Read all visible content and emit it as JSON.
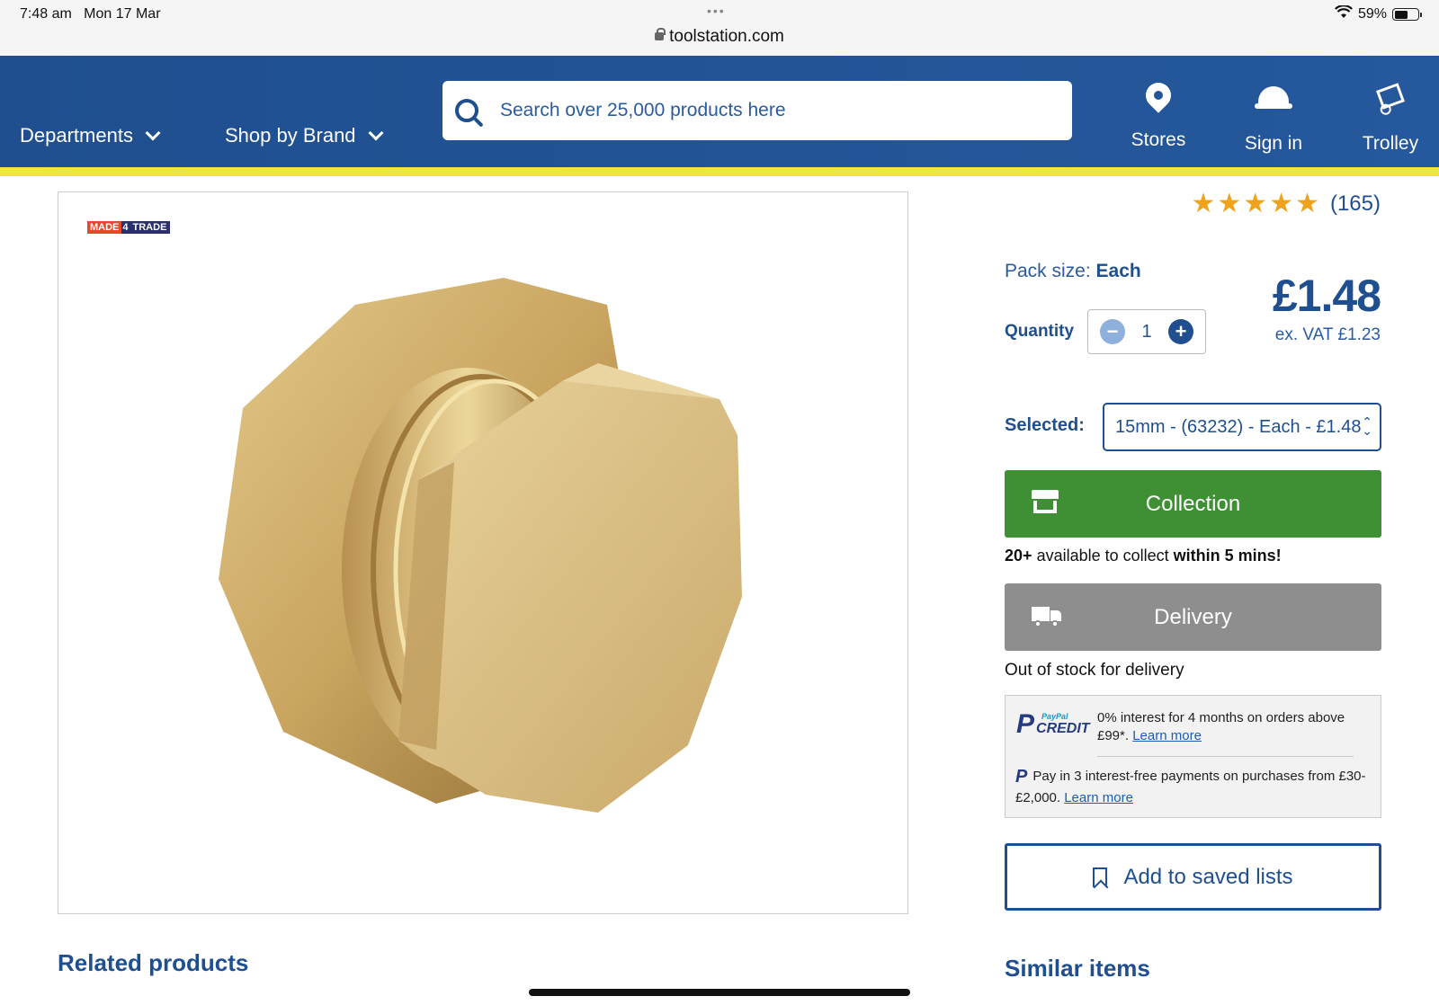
{
  "status_bar": {
    "time": "7:48 am",
    "date": "Mon 17 Mar",
    "url": "toolstation.com",
    "battery": "59%"
  },
  "header": {
    "departments": "Departments",
    "shop_by_brand": "Shop by Brand",
    "search_placeholder": "Search over 25,000 products here",
    "stores": "Stores",
    "sign_in": "Sign in",
    "trolley": "Trolley"
  },
  "product": {
    "badge_left": "MADE",
    "badge_mid": "4",
    "badge_right": "TRADE",
    "rating_stars": 5,
    "rating_count": "(165)",
    "pack_label": "Pack size:",
    "pack_value": "Each",
    "price": "£1.48",
    "price_ex_vat": "ex. VAT £1.23",
    "quantity_label": "Quantity",
    "quantity_value": "1",
    "selected_label": "Selected:",
    "selected_value": "15mm - (63232) - Each - £1.48"
  },
  "fulfilment": {
    "collection_label": "Collection",
    "collect_count": "20+",
    "collect_text": "available to collect",
    "collect_time": "within 5 mins!",
    "delivery_label": "Delivery",
    "delivery_status": "Out of stock for delivery"
  },
  "paypal": {
    "logo_small": "PayPal",
    "logo_credit": "CREDIT",
    "credit_text": "0% interest for 4 months on orders above £99*.",
    "credit_link": "Learn more",
    "pay3_text": "Pay in 3 interest-free payments on purchases from £30-£2,000.",
    "pay3_link": "Learn more"
  },
  "actions": {
    "save_label": "Add to saved lists"
  },
  "sections": {
    "related": "Related products",
    "similar": "Similar items"
  },
  "colors": {
    "brand_blue": "#1f4f8f",
    "accent_yellow": "#f5e33e",
    "collection_green": "#3f8f35",
    "delivery_grey": "#8e8e8e",
    "star_orange": "#f0a21a"
  }
}
